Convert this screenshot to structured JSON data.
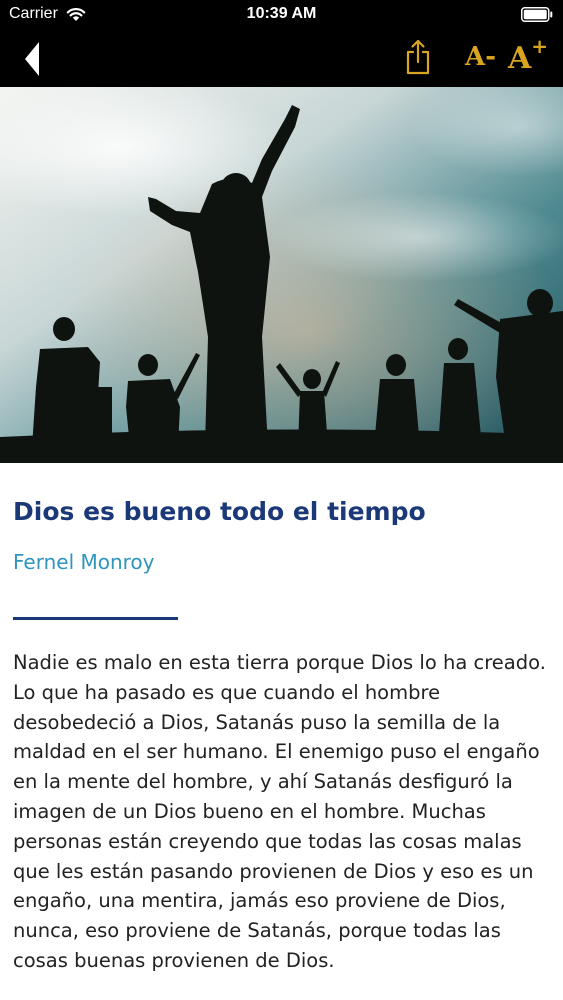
{
  "status_bar": {
    "carrier": "Carrier",
    "time": "10:39 AM",
    "wifi_icon": "wifi-icon",
    "battery_icon": "battery-icon"
  },
  "nav": {
    "back_icon": "chevron-left-icon",
    "share_icon": "share-icon",
    "font_decrease_label": "A",
    "font_decrease_symbol": "-",
    "font_increase_label": "A",
    "font_increase_symbol": "+",
    "accent_color": "#d9a520"
  },
  "article": {
    "title": "Dios es bueno todo el tiempo",
    "author": "Fernel Monroy",
    "body": "Nadie es malo en esta tierra porque Dios lo ha creado. Lo que ha pasado es que cuando el hombre desobedeció a Dios, Satanás puso la semilla de la maldad en el ser humano. El enemigo puso el engaño en la mente del hombre, y ahí Satanás desfiguró la imagen de un Dios bueno en el hombre. Muchas personas están creyendo que todas las cosas malas que les están pasando provienen de Dios y eso es un engaño, una mentira, jamás eso proviene de Dios, nunca, eso proviene de Satanás, porque todas las cosas buenas provienen de Dios.",
    "title_color": "#1b3978",
    "author_color": "#2f95bd"
  }
}
